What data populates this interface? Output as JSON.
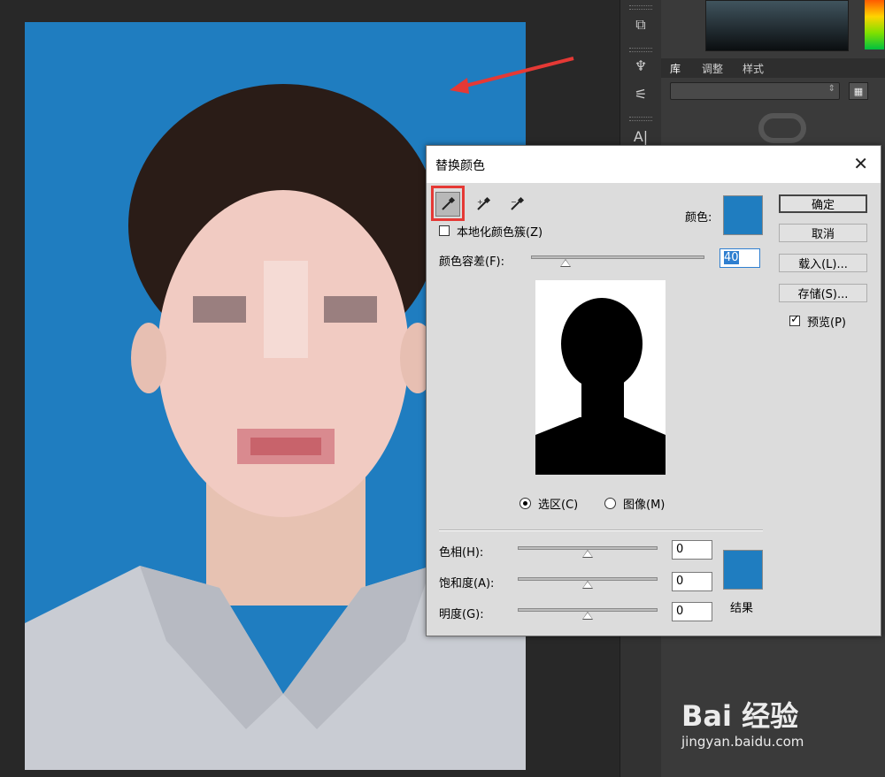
{
  "right_panel": {
    "tabs": [
      "库",
      "调整",
      "样式"
    ],
    "tools": [
      "A|"
    ]
  },
  "dialog": {
    "title": "替换颜色",
    "close_glyph": "✕",
    "localized_label": "本地化颜色簇(Z)",
    "color_label": "颜色:",
    "fuzziness_label": "颜色容差(F):",
    "fuzziness_value": "40",
    "fuzziness_level": 0.2,
    "selection_radio": "选区(C)",
    "image_radio": "图像(M)",
    "hue_label": "色相(H):",
    "hue_value": "0",
    "saturation_label": "饱和度(A):",
    "saturation_value": "0",
    "lightness_label": "明度(G):",
    "lightness_value": "0",
    "result_label": "结果",
    "buttons": {
      "ok": "确定",
      "cancel": "取消",
      "load": "载入(L)...",
      "save": "存储(S)..."
    },
    "preview_label": "预览(P)",
    "selected_color": "#1f7dc0",
    "result_color": "#1f7dc0"
  },
  "watermark": {
    "main": "Bai 经验",
    "sub": "jingyan.baidu.com"
  },
  "colors": {
    "photo_background": "#1f7dc0",
    "highlight": "#e53935"
  }
}
